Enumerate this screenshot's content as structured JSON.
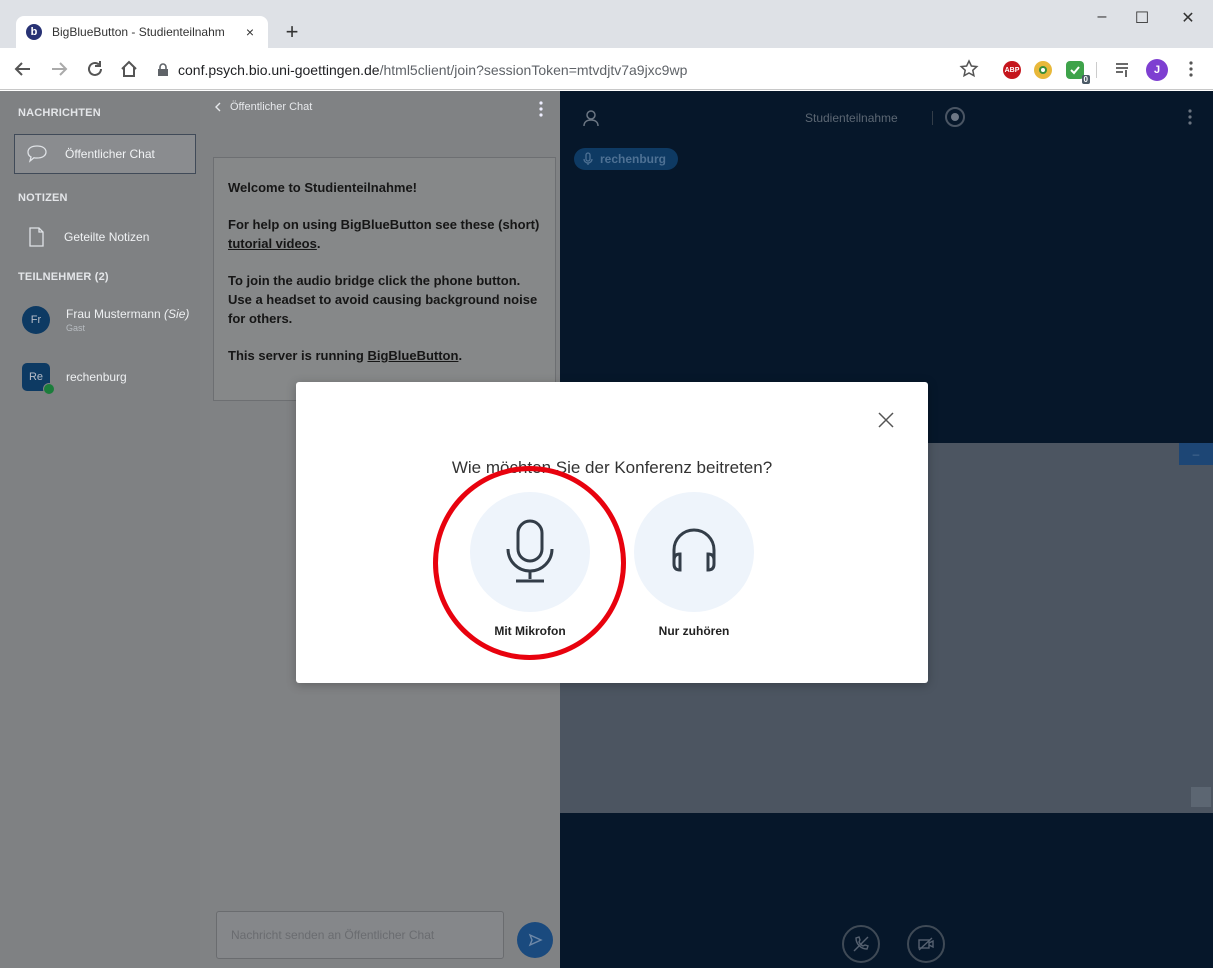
{
  "browser": {
    "tab_title": "BigBlueButton - Studienteilnahm",
    "tab_favicon": "b",
    "new_tab": "+",
    "tab_close": "×",
    "url_host": "conf.psych.bio.uni-goettingen.de",
    "url_path": "/html5client/join?sessionToken=mtvdjtv7a9jxc9wp",
    "profile_initial": "J",
    "abp_label": "ABP",
    "ext_badge": "0",
    "window_controls": {
      "minimize": "–",
      "maximize": "☐",
      "close": "✕"
    }
  },
  "sidebar": {
    "messages_heading": "NACHRICHTEN",
    "public_chat": "Öffentlicher Chat",
    "notes_heading": "NOTIZEN",
    "shared_notes": "Geteilte Notizen",
    "participants_heading": "TEILNEHMER (2)",
    "users": [
      {
        "initials": "Fr",
        "name": "Frau Mustermann",
        "you_suffix": "(Sie)",
        "role": "Gast"
      },
      {
        "initials": "Re",
        "name": "rechenburg"
      }
    ]
  },
  "chat": {
    "header": "Öffentlicher Chat",
    "welcome_title": "Welcome to Studienteilnahme!",
    "help_text": "For help on using BigBlueButton see these (short)",
    "help_link": "tutorial videos",
    "audio_text": "To join the audio bridge click the phone button. Use a headset to avoid causing background noise for others.",
    "server_text": "This server is running",
    "server_link": "BigBlueButton",
    "input_placeholder": "Nachricht senden an Öffentlicher Chat"
  },
  "main": {
    "meeting_title": "Studienteilnahme",
    "talker_name": "rechenburg",
    "minimize_label": "–"
  },
  "modal": {
    "title": "Wie möchten Sie der Konferenz beitreten?",
    "microphone_label": "Mit Mikrofon",
    "listen_only_label": "Nur zuhören"
  },
  "colors": {
    "highlight": "#e8020e",
    "main_background": "#06172a",
    "presentation_area": "#4c5561"
  }
}
